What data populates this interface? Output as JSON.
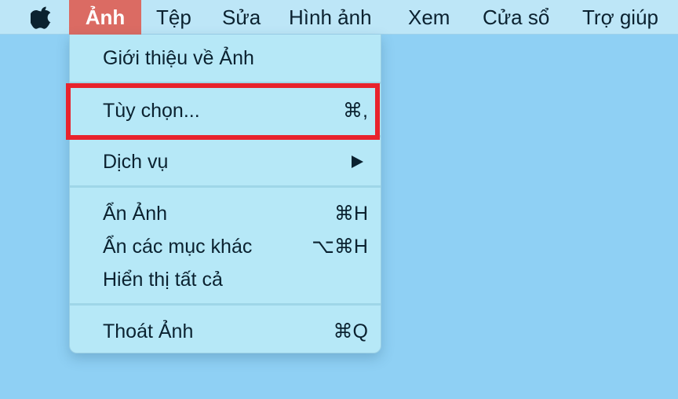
{
  "menubar": {
    "apple_icon": "apple-logo",
    "items": [
      {
        "label": "Ảnh"
      },
      {
        "label": "Tệp"
      },
      {
        "label": "Sửa"
      },
      {
        "label": "Hình ảnh"
      },
      {
        "label": "Xem"
      },
      {
        "label": "Cửa sổ"
      },
      {
        "label": "Trợ giúp"
      }
    ]
  },
  "dropdown": {
    "about": {
      "label": "Giới thiệu về Ảnh"
    },
    "preferences": {
      "label": "Tùy chọn...",
      "shortcut": "⌘,"
    },
    "services": {
      "label": "Dịch vụ",
      "submenu_icon": "triangle-right"
    },
    "hide": {
      "label": "Ẩn Ảnh",
      "shortcut": "⌘H"
    },
    "hide_others": {
      "label": "Ẩn các mục khác",
      "shortcut": "⌥⌘H"
    },
    "show_all": {
      "label": "Hiển thị tất cả"
    },
    "quit": {
      "label": "Thoát Ảnh",
      "shortcut": "⌘Q"
    }
  },
  "colors": {
    "desktop": "#8fd0f4",
    "menubar": "#bde6f7",
    "active_menu": "#db6b63",
    "dropdown": "#b6e8f7",
    "highlight": "#e8222c"
  }
}
